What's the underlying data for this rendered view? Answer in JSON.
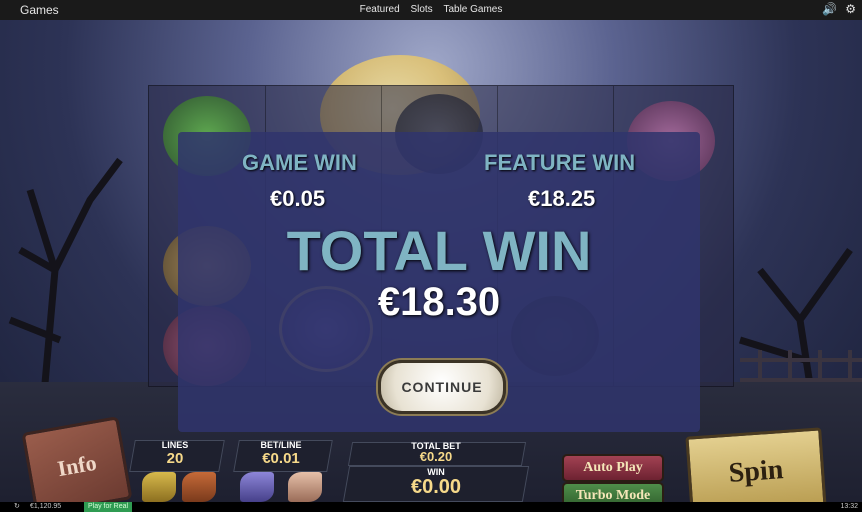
{
  "topbar": {
    "brand": "Games",
    "nav": [
      "Featured",
      "Slots",
      "Table Games"
    ],
    "sound_icon": "speaker-icon",
    "settings_icon": "gear-icon"
  },
  "overlay": {
    "game_win_label": "GAME WIN",
    "game_win_value": "€0.05",
    "feature_win_label": "FEATURE WIN",
    "feature_win_value": "€18.25",
    "total_win_label": "TOTAL WIN",
    "total_win_value": "€18.30",
    "continue_label": "CONTINUE"
  },
  "controls": {
    "info_label": "Info",
    "lines_label": "LINES",
    "lines_value": "20",
    "bet_line_label": "BET/LINE",
    "bet_line_value": "€0.01",
    "total_bet_label": "TOTAL BET",
    "total_bet_value": "€0.20",
    "win_label": "WIN",
    "win_value": "€0.00",
    "auto_play_label": "Auto Play",
    "turbo_mode_label": "Turbo Mode",
    "spin_label": "Spin"
  },
  "statusbar": {
    "balance": "€1,120.95",
    "play_for_real": "Play for Real",
    "clock": "13:32"
  },
  "colors": {
    "overlay_bg": "#30346c",
    "label_teal": "#7fb4c3",
    "value_gold": "#f6d98a"
  }
}
